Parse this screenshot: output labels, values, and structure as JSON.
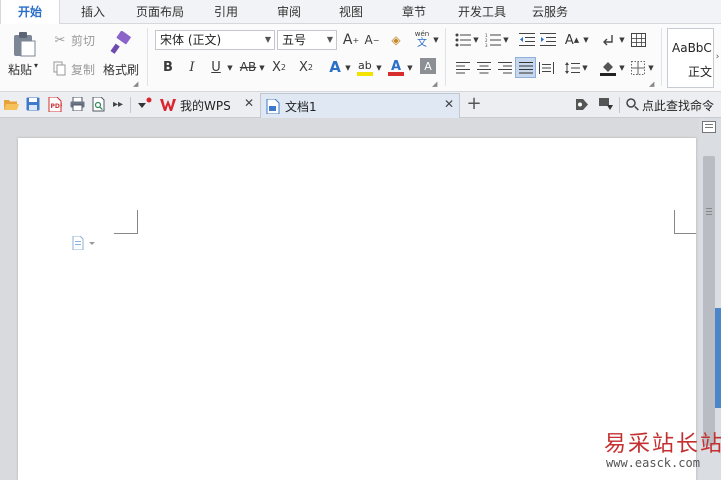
{
  "menu": {
    "tabs": [
      "开始",
      "插入",
      "页面布局",
      "引用",
      "审阅",
      "视图",
      "章节",
      "开发工具",
      "云服务"
    ],
    "active_index": 0
  },
  "ribbon": {
    "paste_label": "粘贴",
    "cut_label": "剪切",
    "copy_label": "复制",
    "format_painter_label": "格式刷",
    "font_name": "宋体 (正文)",
    "font_size": "五号",
    "style_preview_top": "AaBbC",
    "style_preview_bottom": "正文"
  },
  "quickbar": {
    "tabs": [
      {
        "label": "我的WPS"
      },
      {
        "label": "文档1"
      }
    ],
    "active_tab": 1,
    "search_label": "点此查找命令"
  },
  "watermark": {
    "cn": "易采站长站",
    "url": "www.easck.com"
  },
  "colors": {
    "accent": "#2b6fc9",
    "wps_red": "#d9252d",
    "highlight": "#f2e400",
    "font_red": "#d62d2d"
  }
}
